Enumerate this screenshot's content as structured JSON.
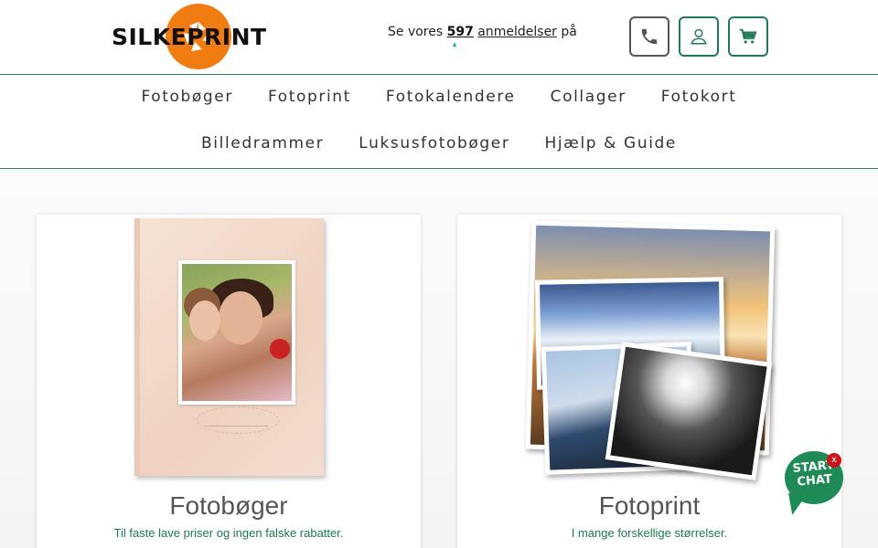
{
  "header": {
    "logo_text": "SILKEPRINT",
    "reviews": {
      "prefix": "Se vores",
      "count": "597",
      "link_text": "anmeldelser",
      "suffix": "på"
    },
    "buttons": [
      {
        "icon": "phone-icon"
      },
      {
        "icon": "user-icon"
      },
      {
        "icon": "cart-icon"
      }
    ]
  },
  "nav": {
    "row1": [
      "Fotobøger",
      "Fotoprint",
      "Fotokalendere",
      "Collager",
      "Fotokort"
    ],
    "row2": [
      "Billedrammer",
      "Luksusfotobøger",
      "Hjælp & Guide"
    ]
  },
  "cards": [
    {
      "title": "Fotobøger",
      "subtitle": "Til faste lave priser og ingen falske rabatter."
    },
    {
      "title": "Fotoprint",
      "subtitle": "I mange forskellige størrelser."
    }
  ],
  "chat": {
    "line1": "START",
    "line2": "CHAT",
    "close": "x"
  },
  "colors": {
    "brand_green": "#1f7a55",
    "logo_orange": "#f07c12",
    "chat_green": "#1f8a56",
    "close_red": "#c8161d"
  }
}
